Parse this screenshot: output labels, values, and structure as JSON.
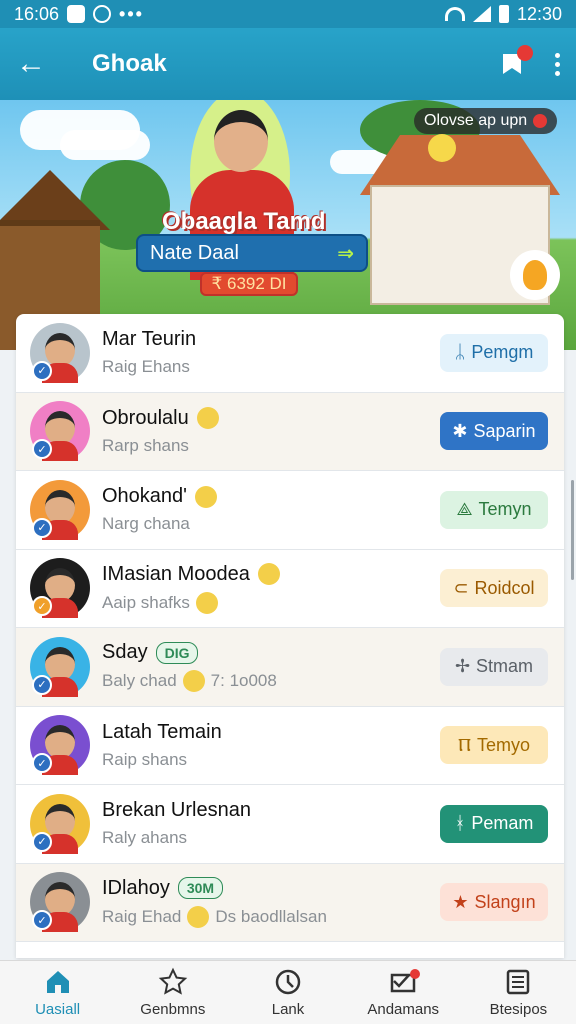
{
  "status": {
    "time": "16:06",
    "dots": "•••",
    "clock": "12:30"
  },
  "appbar": {
    "back_icon": "arrow-left-icon",
    "title": "Ghoak"
  },
  "hero": {
    "heading": "Obaagla Tamd",
    "name_label": "Nate Daal",
    "name_arrow": "⇒",
    "code": "₹ 6392 DI",
    "chip_label": "Olovse ap upn"
  },
  "rows": [
    {
      "name": "Mar Teurin",
      "sub": "Raig Ehans",
      "action": "Pemgm",
      "action_glyph": "ᛦ",
      "action_bg": "#e3f2fb",
      "action_fg": "#1f6fa8",
      "badge_color": "#2d6fc0",
      "avatar_bg": "#b8c4cc",
      "alt": false
    },
    {
      "name": "Obroulalu",
      "sub": "Rarp shans",
      "action": "Saparin",
      "action_glyph": "✱",
      "action_bg": "#2f74c6",
      "action_fg": "#ffffff",
      "badge_color": "#2d6fc0",
      "avatar_bg": "#f07fc5",
      "alt": true,
      "name_emoji": true
    },
    {
      "name": "Ohokand'",
      "sub": "Narg chana",
      "action": "Temyn",
      "action_glyph": "⟁",
      "action_bg": "#dcf3e2",
      "action_fg": "#2b7a3e",
      "badge_color": "#2d6fc0",
      "avatar_bg": "#f39a3a",
      "alt": false,
      "name_emoji": true
    },
    {
      "name": "IMasian Moodea",
      "sub": "Aaip shafks",
      "action": "Roidcol",
      "action_glyph": "⊂",
      "action_bg": "#fcefd3",
      "action_fg": "#9a5a00",
      "badge_color": "#f0a02a",
      "avatar_bg": "#1d1d1d",
      "alt": false,
      "name_emoji": true,
      "sub_emoji": true
    },
    {
      "name": "Sday",
      "tag": "DIG",
      "tag_color": "#2e8b57",
      "sub": "Baly chad",
      "sub_extra": "7: 1o008",
      "action": "Stmam",
      "action_glyph": "✢",
      "action_bg": "#e8eaed",
      "action_fg": "#5b6168",
      "badge_color": "#2d6fc0",
      "avatar_bg": "#39b3e6",
      "alt": true,
      "sub_emoji": true
    },
    {
      "name": "Latah Temain",
      "sub": "Raip shans",
      "action": "Temyo",
      "action_glyph": "Ⲡ",
      "action_bg": "#fde8b8",
      "action_fg": "#a36a00",
      "badge_color": "#2d6fc0",
      "avatar_bg": "#7a4fd0",
      "alt": false
    },
    {
      "name": "Brekan Urlesnan",
      "sub": "Raly ahans",
      "action": "Pemam",
      "action_glyph": "ᚼ",
      "action_bg": "#229277",
      "action_fg": "#ffffff",
      "badge_color": "#2d6fc0",
      "avatar_bg": "#f0c03a",
      "alt": false
    },
    {
      "name": "IDlahoy",
      "tag": "30M",
      "tag_color": "#2e8b57",
      "sub": "Raig Ehad",
      "sub_extra": "Ds baodllalsan",
      "action": "Slangın",
      "action_glyph": "★",
      "action_bg": "#fde1d7",
      "action_fg": "#c2411a",
      "badge_color": "#2d6fc0",
      "avatar_bg": "#8a8f94",
      "alt": true,
      "sub_emoji": true
    }
  ],
  "nav": [
    {
      "label": "Uasiall",
      "icon": "home-icon",
      "active": true
    },
    {
      "label": "Genbmns",
      "icon": "star-icon",
      "active": false
    },
    {
      "label": "Lank",
      "icon": "clock-icon",
      "active": false
    },
    {
      "label": "Andamans",
      "icon": "mail-icon",
      "active": false,
      "dot": true
    },
    {
      "label": "Btesipos",
      "icon": "list-icon",
      "active": false
    }
  ]
}
